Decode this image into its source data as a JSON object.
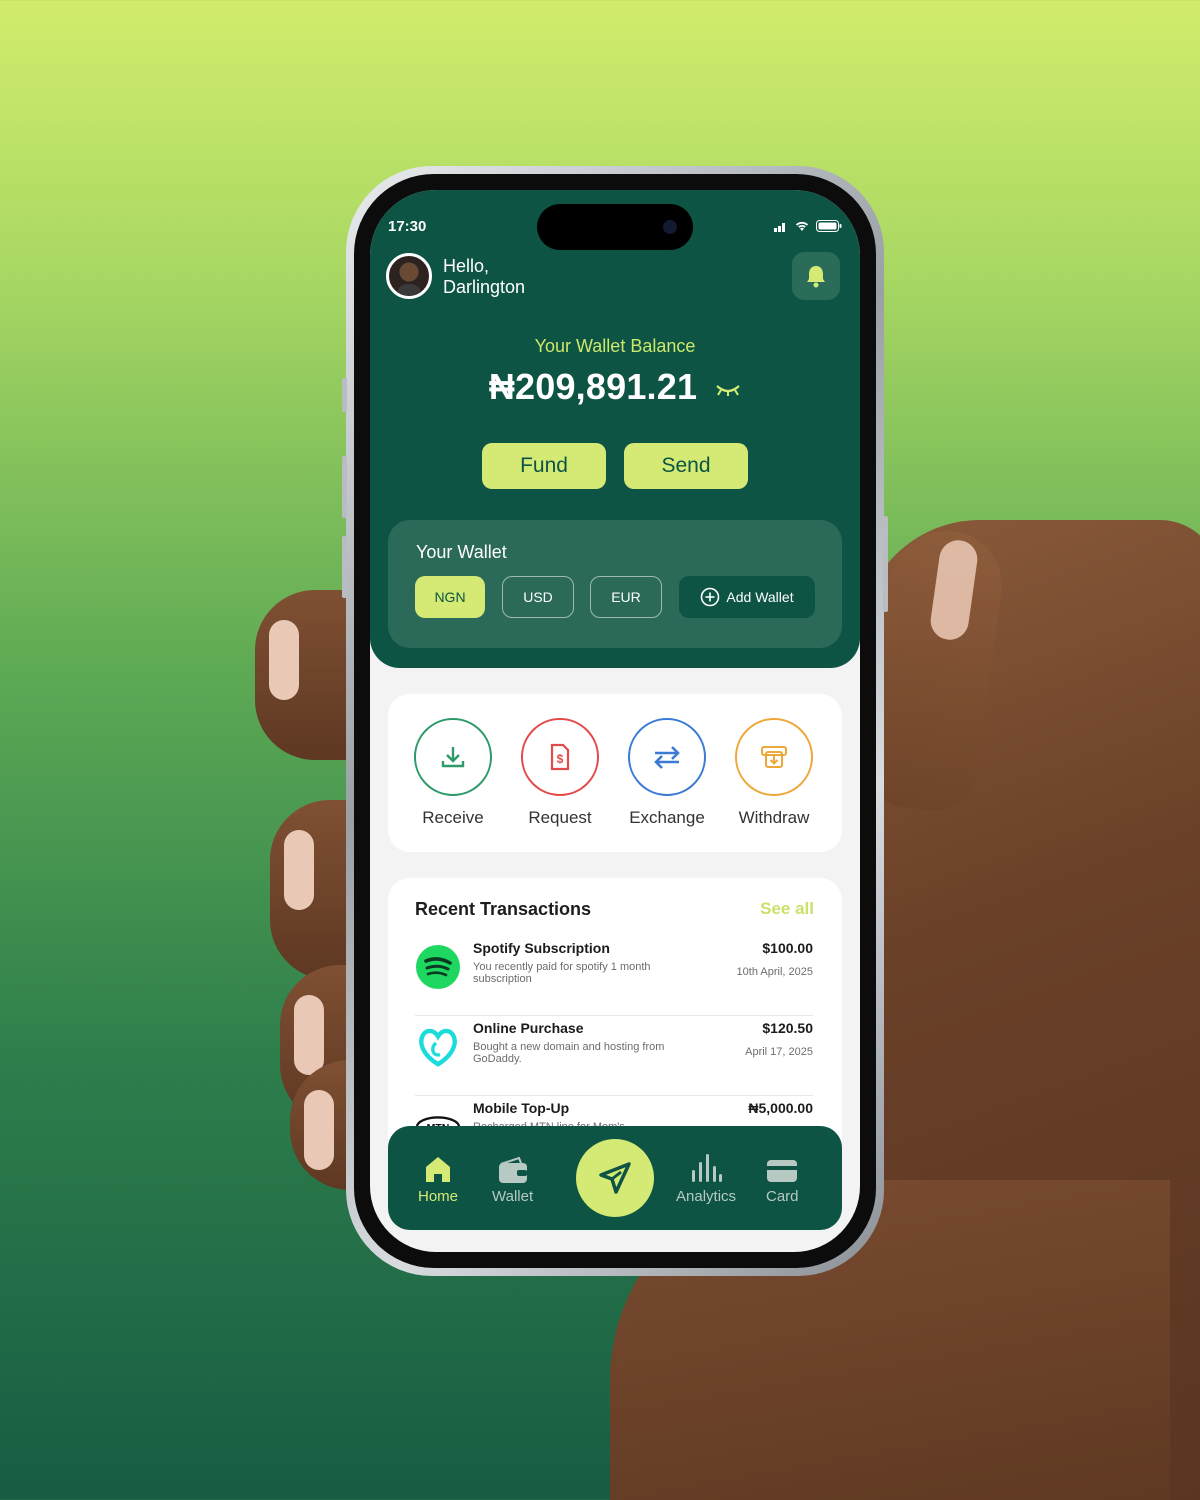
{
  "status": {
    "time": "17:30"
  },
  "header": {
    "greeting_line1": "Hello,",
    "greeting_line2": "Darlington"
  },
  "balance": {
    "label": "Your Wallet Balance",
    "amount": "₦209,891.21"
  },
  "actions": {
    "fund": "Fund",
    "send": "Send"
  },
  "wallet": {
    "title": "Your Wallet",
    "currencies": [
      "NGN",
      "USD",
      "EUR"
    ],
    "selected": "NGN",
    "add_label": "Add Wallet"
  },
  "quick_actions": [
    {
      "label": "Receive",
      "icon": "download-icon",
      "color": "#2e9a6a"
    },
    {
      "label": "Request",
      "icon": "invoice-dollar-icon",
      "color": "#e24b4b"
    },
    {
      "label": "Exchange",
      "icon": "swap-arrows-icon",
      "color": "#3a7bd5"
    },
    {
      "label": "Withdraw",
      "icon": "atm-withdraw-icon",
      "color": "#eea83a"
    }
  ],
  "transactions": {
    "title": "Recent Transactions",
    "see_all": "See all",
    "items": [
      {
        "name": "Spotify Subscription",
        "desc": "You recently paid for spotify 1 month subscription",
        "amount": "$100.00",
        "date": "10th April, 2025",
        "logo": "spotify-logo"
      },
      {
        "name": "Online Purchase",
        "desc": "Bought a new domain and hosting from GoDaddy.",
        "amount": "$120.50",
        "date": "April 17, 2025",
        "logo": "godaddy-logo"
      },
      {
        "name": "Mobile Top-Up",
        "desc": "Recharged MTN line for Mom's",
        "amount": "₦5,000.00",
        "date": "",
        "logo": "mtn-logo"
      }
    ],
    "mtn_text": "MTN"
  },
  "nav": {
    "home": "Home",
    "wallet": "Wallet",
    "analytics": "Analytics",
    "card": "Card"
  },
  "colors": {
    "primary": "#0d5444",
    "accent": "#d4ea74",
    "card": "#2b6a59"
  }
}
